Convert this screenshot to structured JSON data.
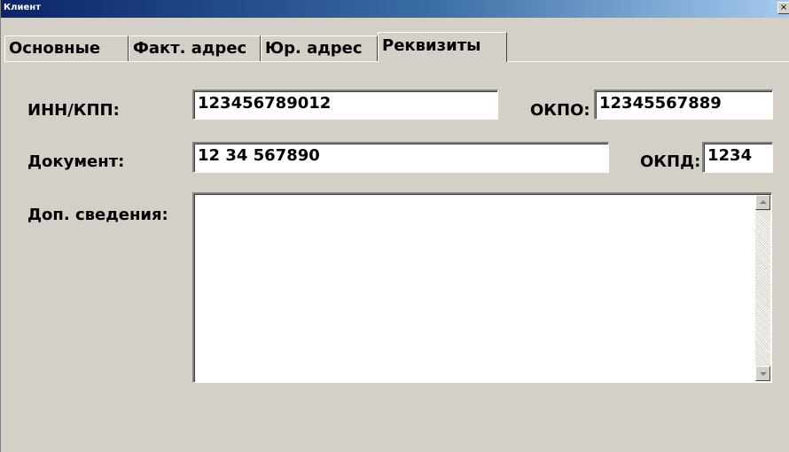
{
  "window": {
    "title": "Клиент",
    "close_glyph": "×"
  },
  "tabs": [
    {
      "label": "Основные",
      "active": false
    },
    {
      "label": "Факт. адрес",
      "active": false
    },
    {
      "label": "Юр. адрес",
      "active": false
    },
    {
      "label": "Реквизиты",
      "active": true
    }
  ],
  "form": {
    "inn_label": "ИНН/КПП:",
    "inn_value": "123456789012",
    "okpo_label": "ОКПО:",
    "okpo_value": "12345567889",
    "document_label": "Документ:",
    "document_value": "12 34 567890",
    "okpd_label": "ОКПД:",
    "okpd_value": "1234",
    "extra_label": "Доп. сведения:",
    "extra_value": ""
  },
  "icons": {
    "close": "close-icon",
    "scroll_up": "arrow-up-icon",
    "scroll_down": "arrow-down-icon"
  },
  "colors": {
    "title_start": "#0a246a",
    "title_end": "#a6caf0",
    "face": "#d4d0c8"
  }
}
